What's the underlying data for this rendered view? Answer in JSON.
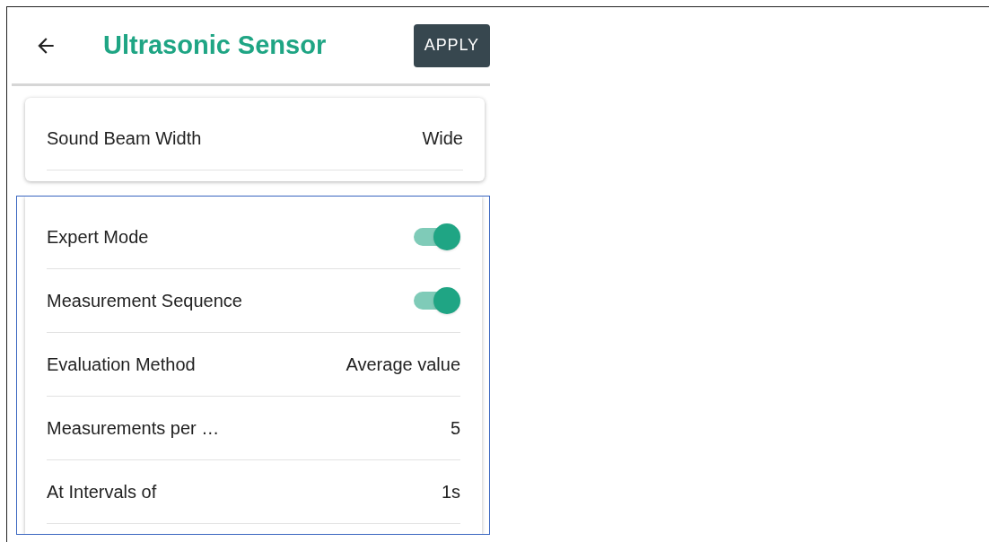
{
  "header": {
    "title": "Ultrasonic Sensor",
    "apply_button": "APPLY"
  },
  "basic_settings": [
    {
      "kind": "value",
      "label": "Sound Beam Width",
      "value": "Wide"
    }
  ],
  "expert_settings": [
    {
      "kind": "toggle",
      "label": "Expert Mode",
      "on": true
    },
    {
      "kind": "toggle",
      "label": "Measurement Sequence",
      "on": true
    },
    {
      "kind": "value",
      "label": "Evaluation Method",
      "value": "Average value"
    },
    {
      "kind": "value",
      "label": "Measurements per …",
      "value": "5"
    },
    {
      "kind": "value",
      "label": "At Intervals of",
      "value": "1s"
    }
  ]
}
